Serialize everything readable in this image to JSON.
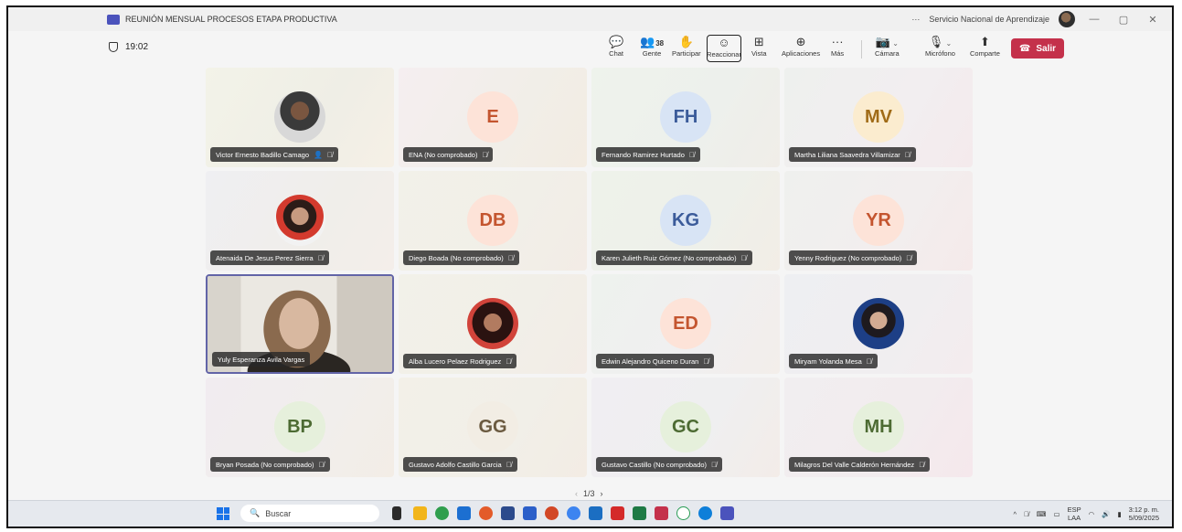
{
  "window": {
    "title": "REUNIÓN MENSUAL PROCESOS ETAPA PRODUCTIVA",
    "more": "···",
    "org": "Servicio Nacional de Aprendizaje"
  },
  "meeting": {
    "timer": "19:02",
    "toolbar": {
      "chat": "Chat",
      "people": "Gente",
      "people_count": "38",
      "raise": "Participar",
      "react": "Reaccionar",
      "view": "Vista",
      "apps": "Aplicaciones",
      "more": "Más",
      "camera": "Cámara",
      "mic": "Micrófono",
      "share": "Comparte",
      "leave": "Salir"
    },
    "pager": "1/3"
  },
  "tiles": [
    {
      "name": "Victor Ernesto Badillo Camago",
      "type": "photo"
    },
    {
      "name": "ENA (No comprobado)",
      "initials": "E",
      "type": "initials",
      "color": "#fde3d8",
      "text_color": "#c4552f"
    },
    {
      "name": "Fernando Ramirez Hurtado",
      "initials": "FH",
      "type": "initials",
      "color": "#d8e4f5",
      "text_color": "#3b5b9a"
    },
    {
      "name": "Martha Liliana Saavedra Villamizar",
      "initials": "MV",
      "type": "initials",
      "color": "#fbeccf",
      "text_color": "#a06b17"
    },
    {
      "name": "Atenaida De Jesus Perez Sierra",
      "type": "photo"
    },
    {
      "name": "Diego Boada (No comprobado)",
      "initials": "DB",
      "type": "initials",
      "color": "#fde3d8",
      "text_color": "#c4552f"
    },
    {
      "name": "Karen Julieth Ruiz Gómez (No comprobado)",
      "initials": "KG",
      "type": "initials",
      "color": "#d8e4f5",
      "text_color": "#3b5b9a"
    },
    {
      "name": "Yenny Rodriguez (No comprobado)",
      "initials": "YR",
      "type": "initials",
      "color": "#fde3d8",
      "text_color": "#c4552f"
    },
    {
      "name": "Yuly Esperanza Avila Vargas",
      "type": "video"
    },
    {
      "name": "Alba Lucero Pelaez Rodriguez",
      "type": "photo"
    },
    {
      "name": "Edwin Alejandro Quiceno Duran",
      "initials": "ED",
      "type": "initials",
      "color": "#fde3d8",
      "text_color": "#c4552f"
    },
    {
      "name": "Miryam Yolanda Mesa",
      "type": "photo"
    },
    {
      "name": "Bryan Posada (No comprobado)",
      "initials": "BP",
      "type": "initials",
      "color": "#e6f0dc",
      "text_color": "#4d6b33"
    },
    {
      "name": "Gustavo Adolfo Castillo Garcia",
      "initials": "GG",
      "type": "initials",
      "color": "#f2ede4",
      "text_color": "#6b5a40"
    },
    {
      "name": "Gustavo Castillo (No comprobado)",
      "initials": "GC",
      "type": "initials",
      "color": "#e6f0dc",
      "text_color": "#4d6b33"
    },
    {
      "name": "Milagros Del Valle Calderón Hernández",
      "initials": "MH",
      "type": "initials",
      "color": "#e6f0dc",
      "text_color": "#4d6b33"
    }
  ],
  "taskbar": {
    "search_placeholder": "Buscar",
    "lang_top": "ESP",
    "lang_bottom": "LAA",
    "time": "3:12 p. m.",
    "date": "5/09/2025"
  },
  "colors": {
    "leave": "#c4314b",
    "accent": "#6264a7"
  }
}
